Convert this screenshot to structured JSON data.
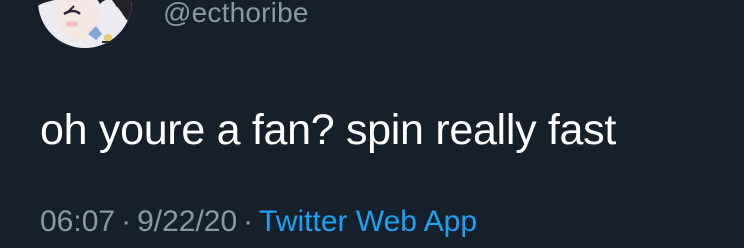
{
  "tweet": {
    "handle": "@ecthoribe",
    "text": "oh youre a fan? spin really fast",
    "time": "06:07",
    "separator": "·",
    "date": "9/22/20",
    "source": "Twitter Web App"
  },
  "colors": {
    "background": "#15202b",
    "text": "#ffffff",
    "secondary": "#8899a6",
    "link": "#1da1f2"
  }
}
